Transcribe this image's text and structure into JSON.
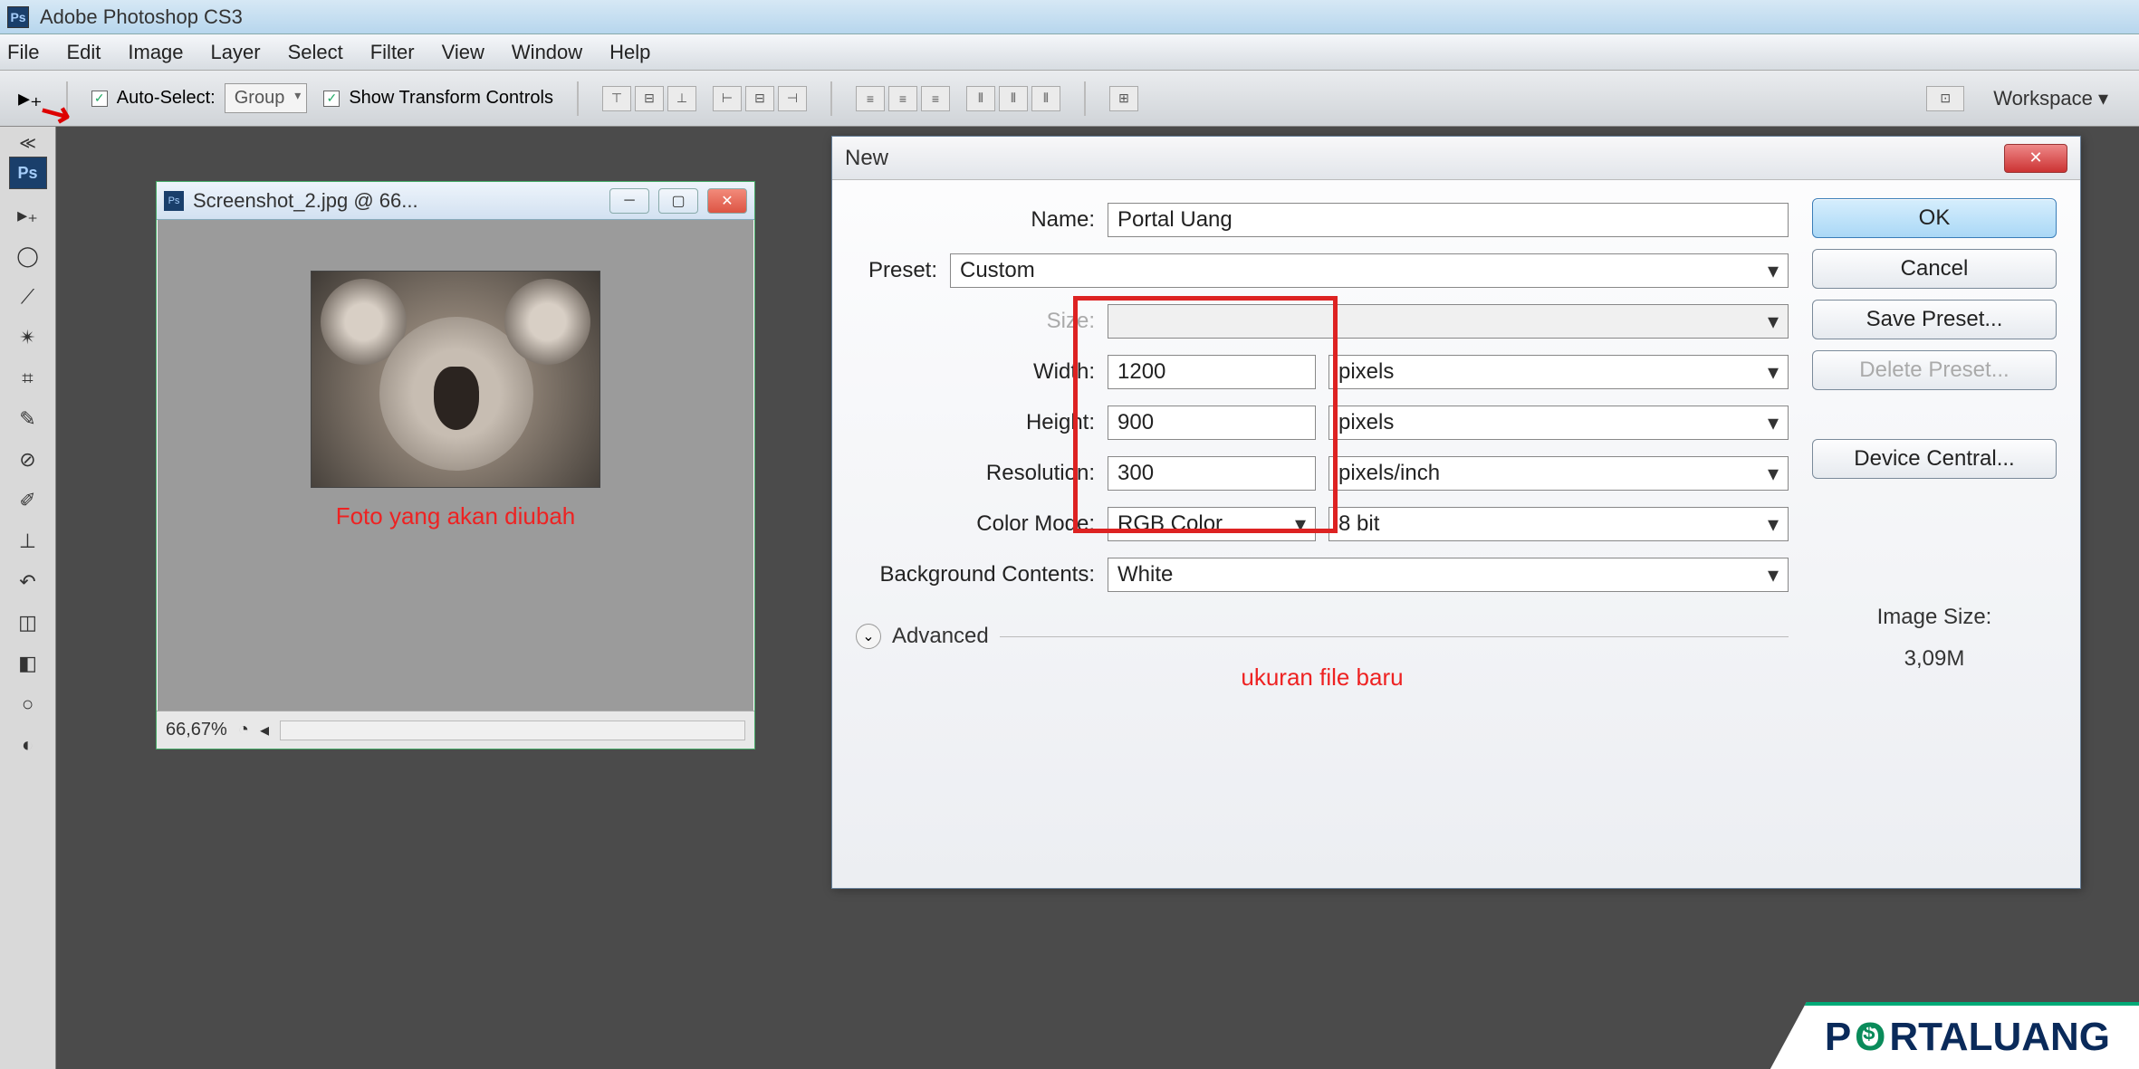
{
  "app_title": "Adobe Photoshop CS3",
  "menu": [
    "File",
    "Edit",
    "Image",
    "Layer",
    "Select",
    "Filter",
    "View",
    "Window",
    "Help"
  ],
  "options": {
    "auto_select_label": "Auto-Select:",
    "auto_select_value": "Group",
    "show_transform_label": "Show Transform Controls",
    "workspace_label": "Workspace ▾"
  },
  "doc": {
    "title": "Screenshot_2.jpg @ 66...",
    "zoom": "66,67%",
    "annotation": "Foto yang akan diubah"
  },
  "dialog": {
    "title": "New",
    "name_label": "Name:",
    "name_value": "Portal Uang",
    "preset_label": "Preset:",
    "preset_value": "Custom",
    "size_label": "Size:",
    "width_label": "Width:",
    "width_value": "1200",
    "width_unit": "pixels",
    "height_label": "Height:",
    "height_value": "900",
    "height_unit": "pixels",
    "res_label": "Resolution:",
    "res_value": "300",
    "res_unit": "pixels/inch",
    "color_label": "Color Mode:",
    "color_value": "RGB Color",
    "color_bits": "8 bit",
    "bg_label": "Background Contents:",
    "bg_value": "White",
    "advanced_label": "Advanced",
    "annotation": "ukuran file baru",
    "ok": "OK",
    "cancel": "Cancel",
    "save_preset": "Save Preset...",
    "delete_preset": "Delete Preset...",
    "device_central": "Device Central...",
    "image_size_label": "Image Size:",
    "image_size_value": "3,09M"
  },
  "watermark": {
    "p": "P",
    "o": "O",
    "rest": "RTALUANG"
  }
}
